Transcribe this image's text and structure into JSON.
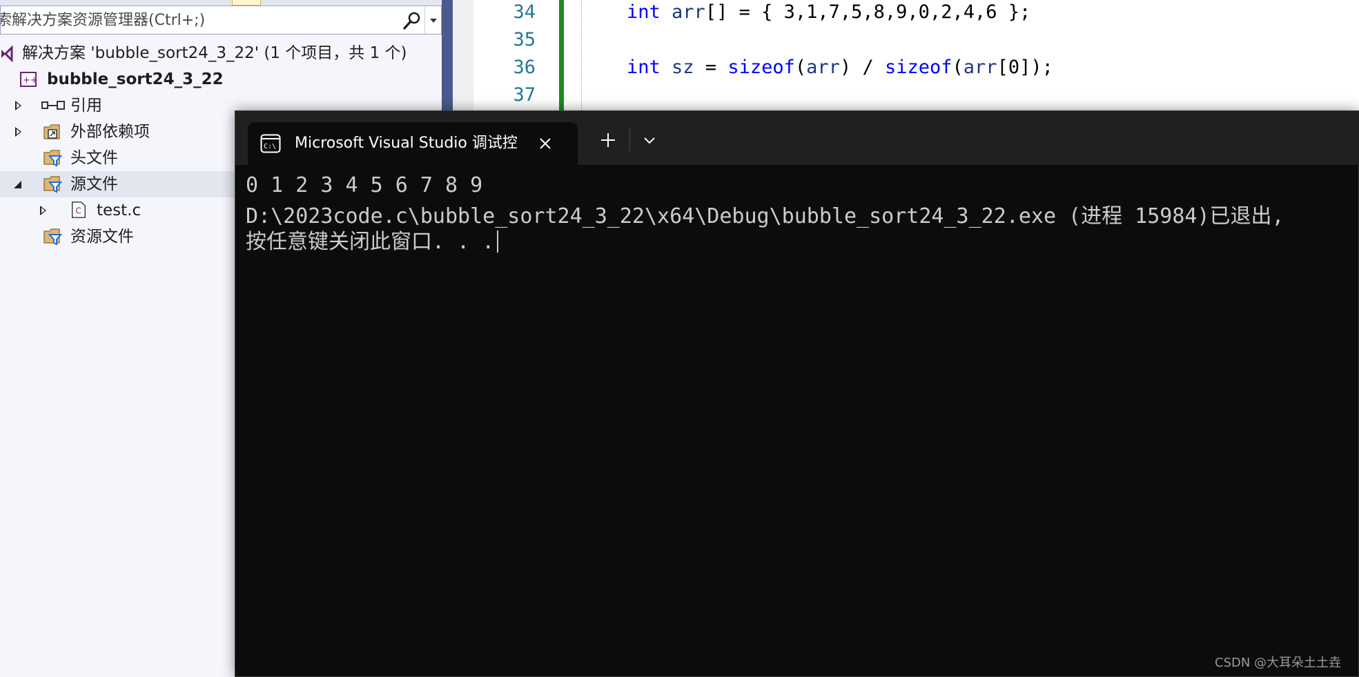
{
  "search": {
    "placeholder": "索解决方案资源管理器(Ctrl+;)"
  },
  "tree": {
    "solution_label": "解决方案 'bubble_sort24_3_22' (1 个项目，共 1 个)",
    "project_label": "bubble_sort24_3_22",
    "items": [
      {
        "label": "引用",
        "icon": "reference-icon",
        "state": "collapsed"
      },
      {
        "label": "外部依赖项",
        "icon": "external-dependencies-icon",
        "state": "collapsed"
      },
      {
        "label": "头文件",
        "icon": "filter-folder-icon",
        "state": "none"
      },
      {
        "label": "源文件",
        "icon": "filter-folder-icon",
        "state": "expanded",
        "selected": true
      },
      {
        "label": "test.c",
        "icon": "c-file-icon",
        "state": "collapsed"
      },
      {
        "label": "资源文件",
        "icon": "filter-folder-icon",
        "state": "none"
      }
    ]
  },
  "editor": {
    "line_numbers": [
      "34",
      "35",
      "36",
      "37"
    ],
    "code": {
      "line34": {
        "kw": "int",
        "var": "arr",
        "rest": "[] = { 3,1,7,5,8,9,0,2,4,6 };"
      },
      "line36": {
        "kw": "int",
        "var": "sz",
        "eq": " = ",
        "fn1": "sizeof",
        "p1": "(",
        "var2": "arr",
        "p2": ") / ",
        "fn2": "sizeof",
        "p3": "(",
        "var3": "arr",
        "rest": "[0]);"
      }
    }
  },
  "terminal": {
    "tab_title": "Microsoft Visual Studio 调试控",
    "output_line1": "0 1 2 3 4 5 6 7 8 9",
    "output_line2": "D:\\2023code.c\\bubble_sort24_3_22\\x64\\Debug\\bubble_sort24_3_22.exe (进程 15984)已退出,",
    "output_line3": "按任意键关闭此窗口. . ."
  },
  "watermark": "CSDN @大耳朵土土垚",
  "colors": {
    "keyword": "#0000ff",
    "change_bar": "#1f8a22",
    "terminal_bg": "#0c0c0c",
    "terminal_text": "#cccccc"
  }
}
